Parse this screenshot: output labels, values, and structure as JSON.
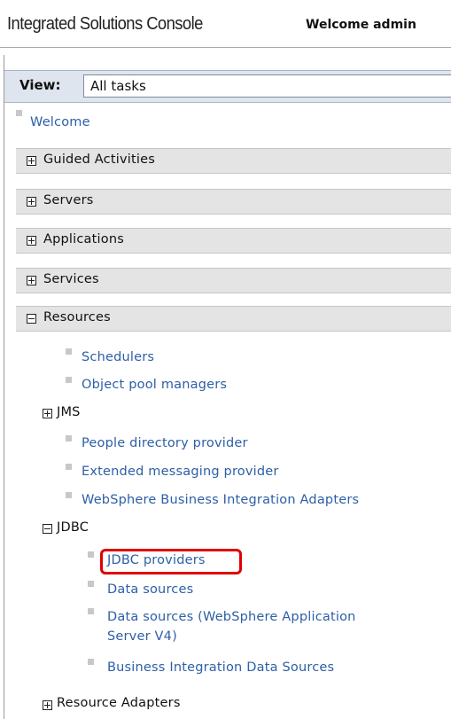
{
  "banner": {
    "title": "Integrated Solutions Console",
    "welcome": "Welcome admin"
  },
  "view": {
    "label": "View:",
    "selected": "All tasks"
  },
  "welcome_link": "Welcome",
  "sections": {
    "guided_activities": "Guided Activities",
    "servers": "Servers",
    "applications": "Applications",
    "services": "Services",
    "resources": "Resources"
  },
  "resources": {
    "schedulers": "Schedulers",
    "object_pool_managers": "Object pool managers",
    "jms": "JMS",
    "people_directory_provider": "People directory provider",
    "extended_messaging_provider": "Extended messaging provider",
    "websphere_bia": "WebSphere Business Integration Adapters",
    "jdbc": "JDBC",
    "jdbc_items": {
      "jdbc_providers": "JDBC providers",
      "data_sources": "Data sources",
      "data_sources_v4_line1": "Data sources (WebSphere Application",
      "data_sources_v4_line2": "Server V4)",
      "bi_data_sources": "Business Integration Data Sources"
    },
    "resource_adapters": "Resource Adapters"
  },
  "colors": {
    "link": "#2d5fa6",
    "section_bg": "#e4e4e4",
    "view_bar_bg": "#dfe5ee",
    "highlight": "#e00000"
  },
  "icons": {
    "expand": "plus-box-icon",
    "collapse": "minus-box-icon",
    "bullet": "square-bullet-icon"
  }
}
